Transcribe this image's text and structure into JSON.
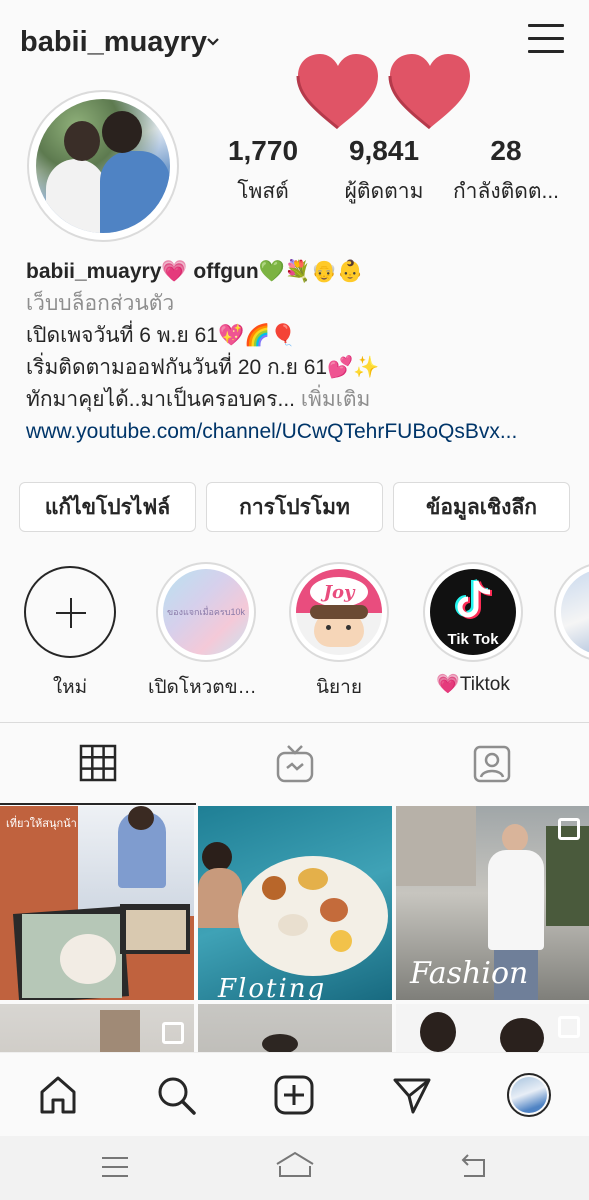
{
  "header": {
    "username": "babii_muayry"
  },
  "stats": [
    {
      "value": "1,770",
      "label": "โพสต์"
    },
    {
      "value": "9,841",
      "label": "ผู้ติดตาม"
    },
    {
      "value": "28",
      "label": "กำลังติดต..."
    }
  ],
  "bio": {
    "name": "babii_muayry💗 offgun💚💐👴👶",
    "category": "เว็บบล็อกส่วนตัว",
    "line1": "เปิดเพจวันที่ 6 พ.ย 61💖🌈🎈",
    "line2": "เริ่มติดตามออฟกันวันที่ 20 ก.ย 61💕✨",
    "line3": "ทักมาคุยได้..มาเป็นครอบคร...",
    "more": "เพิ่มเติม",
    "link": "www.youtube.com/channel/UCwQTehrFUBoQsBvx..."
  },
  "buttons": {
    "edit": "แก้ไขโปรไฟล์",
    "promote": "การโปรโมท",
    "insights": "ข้อมูลเชิงลึก"
  },
  "highlights": [
    {
      "label": "ใหม่"
    },
    {
      "label": "เปิดโหวตของ...",
      "inner_text": "ของแจกเมื่อครบ10k"
    },
    {
      "label": "นิยาย",
      "inner_text": "Joy"
    },
    {
      "label": "💗Tiktok",
      "inner_text": "Tik Tok"
    }
  ],
  "grid": {
    "post1_text": "เที่ยวให้สนุกน้า",
    "post2_text": "Floting",
    "post3_text": "Fashion"
  },
  "colors": {
    "link": "#003569",
    "secondary": "#8e8e8e",
    "heart": "#e05466"
  }
}
